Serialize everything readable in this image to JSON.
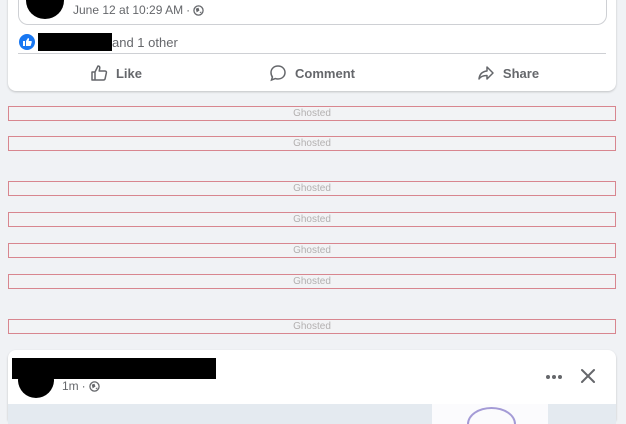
{
  "top_post": {
    "timestamp": "June 12 at 10:29 AM",
    "separator": "·",
    "reactions_text": "and 1 other",
    "actions": {
      "like": "Like",
      "comment": "Comment",
      "share": "Share"
    }
  },
  "ghosted_items": [
    "Ghosted",
    "Ghosted",
    "Ghosted",
    "Ghosted",
    "Ghosted",
    "Ghosted",
    "Ghosted"
  ],
  "bottom_post": {
    "time": "1m",
    "separator": "·"
  },
  "colors": {
    "accent": "#1877f2",
    "background": "#f0f2f5",
    "ghost_border": "#d8868f",
    "muted_text": "#65676b"
  }
}
